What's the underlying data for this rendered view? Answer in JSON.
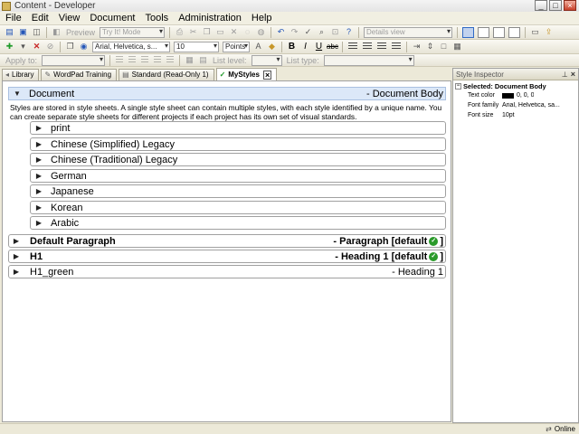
{
  "window": {
    "title": "Content - Developer"
  },
  "menu": [
    "File",
    "Edit",
    "View",
    "Document",
    "Tools",
    "Administration",
    "Help"
  ],
  "toolbar1": {
    "preview_label": "Preview",
    "mode_value": "Try It! Mode",
    "view_value": "Details view"
  },
  "toolbar2": {
    "font_value": "Arial, Helvetica, s...",
    "size_value": "10",
    "unit_value": "Points",
    "bold_label": "B",
    "italic_label": "I",
    "underline_label": "U",
    "strike_label": "abc"
  },
  "toolbar3": {
    "apply_to_label": "Apply to:",
    "list_level_label": "List level:",
    "list_type_label": "List type:"
  },
  "tabs": [
    {
      "label": "Library",
      "icon": "library-icon"
    },
    {
      "label": "WordPad Training",
      "icon": "document-icon"
    },
    {
      "label": "Standard (Read-Only 1)",
      "icon": "stylesheet-icon"
    },
    {
      "label": "MyStyles",
      "icon": "stylesheet-check-icon",
      "active": true
    }
  ],
  "document": {
    "header_name": "Document",
    "header_right": "- Document Body",
    "description": "Styles are stored in style sheets. A single style sheet can contain multiple styles, with each style identified by a unique name. You can create separate style sheets for different projects if each project has its own set of visual standards.",
    "sub_items": [
      "print",
      "Chinese (Simplified) Legacy",
      "Chinese (Traditional) Legacy",
      "German",
      "Japanese",
      "Korean",
      "Arabic"
    ],
    "top_items": [
      {
        "name": "Default Paragraph",
        "right_prefix": "- Paragraph [default",
        "right_suffix": "]",
        "check": true,
        "bold": true
      },
      {
        "name": "H1",
        "right_prefix": "- Heading 1 [default",
        "right_suffix": "]",
        "check": true,
        "bold": true
      },
      {
        "name": "H1_green",
        "right_prefix": "- Heading 1",
        "right_suffix": "",
        "check": false,
        "bold": false
      }
    ]
  },
  "inspector": {
    "title": "Style Inspector",
    "selected": "Selected: Document Body",
    "properties": [
      {
        "name": "Text color",
        "value": "0, 0, 0",
        "swatch": "#000000"
      },
      {
        "name": "Font family",
        "value": "Arial, Helvetica, sa..."
      },
      {
        "name": "Font size",
        "value": "10pt"
      }
    ]
  },
  "status": {
    "text": "Online"
  },
  "colors": {
    "header_bg": "#dce8f8",
    "check_green": "#2a9a2a",
    "chrome": "#ece9d8"
  }
}
